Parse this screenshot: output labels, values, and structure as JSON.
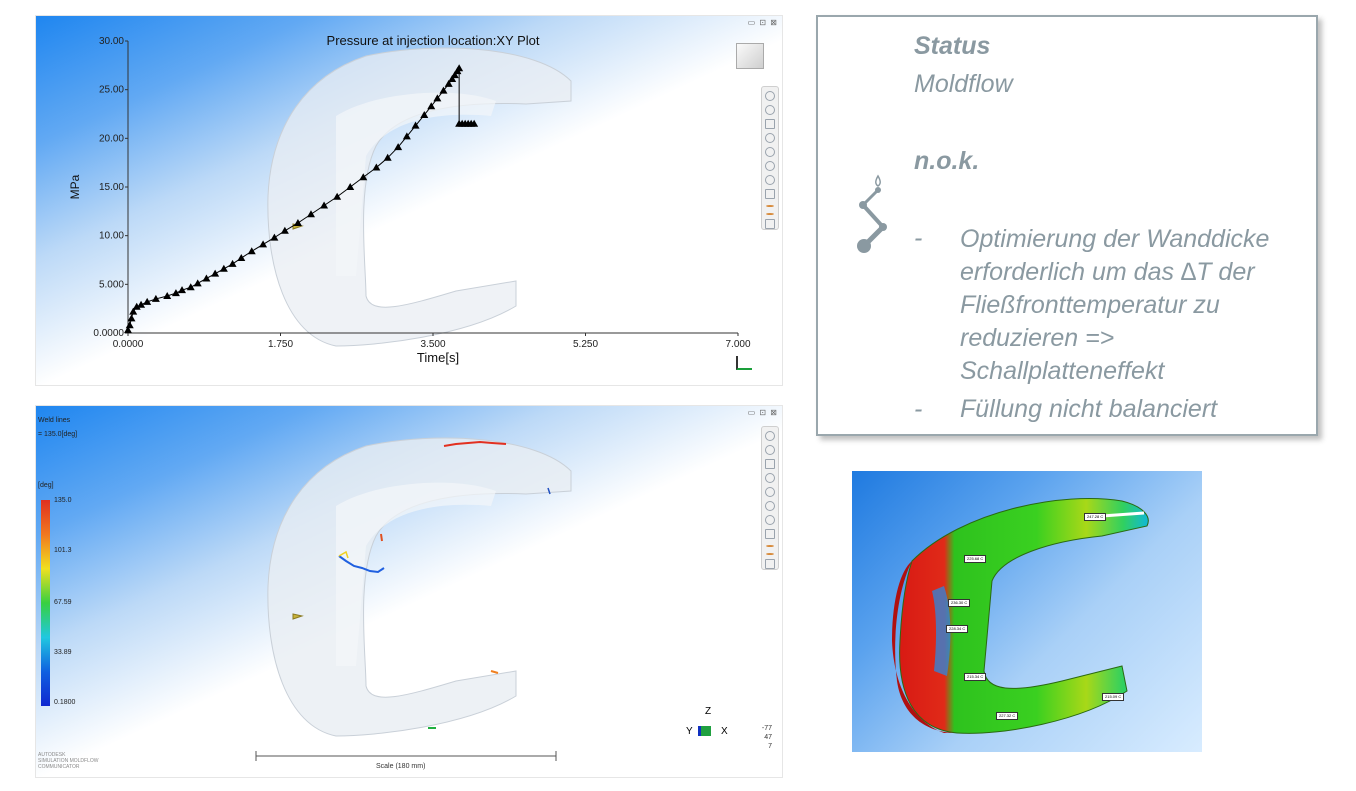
{
  "plot_panel": {
    "title": "Pressure at injection location:XY Plot",
    "window_controls": "▭ ⊡ ⊠"
  },
  "chart_data": {
    "type": "scatter",
    "title": "Pressure at injection location:XY Plot",
    "xlabel": "Time[s]",
    "ylabel": "MPa",
    "xlim": [
      0,
      7.0
    ],
    "ylim": [
      0,
      30.0
    ],
    "x_ticks": [
      "0.0000",
      "1.750",
      "3.500",
      "5.250",
      "7.000"
    ],
    "y_ticks": [
      "0.0000",
      "5.000",
      "10.00",
      "15.00",
      "20.00",
      "25.00",
      "30.00"
    ],
    "x": [
      0.0,
      0.02,
      0.04,
      0.06,
      0.1,
      0.15,
      0.22,
      0.32,
      0.45,
      0.55,
      0.62,
      0.72,
      0.8,
      0.9,
      1.0,
      1.1,
      1.2,
      1.3,
      1.42,
      1.55,
      1.68,
      1.8,
      1.95,
      2.1,
      2.25,
      2.4,
      2.55,
      2.7,
      2.85,
      2.98,
      3.1,
      3.2,
      3.3,
      3.4,
      3.48,
      3.55,
      3.62,
      3.68,
      3.72,
      3.75,
      3.78,
      3.8
    ],
    "y": [
      0.3,
      0.8,
      1.5,
      2.2,
      2.7,
      2.9,
      3.2,
      3.5,
      3.8,
      4.1,
      4.4,
      4.7,
      5.1,
      5.6,
      6.1,
      6.6,
      7.1,
      7.7,
      8.4,
      9.1,
      9.8,
      10.5,
      11.3,
      12.2,
      13.1,
      14.0,
      15.0,
      16.0,
      17.0,
      18.0,
      19.1,
      20.2,
      21.3,
      22.4,
      23.3,
      24.1,
      24.9,
      25.6,
      26.1,
      26.5,
      26.9,
      27.2
    ],
    "drop_x": 3.8,
    "drop_y": 21.5,
    "marker": "triangle",
    "color": "#000000"
  },
  "weld_panel": {
    "result_name": "Weld lines",
    "result_value": "= 135.0[deg]",
    "unit": "[deg]",
    "legend_ticks": [
      "135.0",
      "101.3",
      "67.59",
      "33.89",
      "0.1800"
    ],
    "scale_label": "Scale (180 mm)",
    "axis_labels": {
      "z": "Z",
      "y": "Y",
      "x": "X"
    },
    "view_angles": [
      "-77",
      "47",
      "7"
    ],
    "footer_lines": [
      "AUTODESK",
      "SIMULATION MOLDFLOW",
      "COMMUNICATOR"
    ]
  },
  "status_box": {
    "heading": "Status",
    "subheading": "Moldflow",
    "verdict": "n.o.k.",
    "dash": "-",
    "bullets": [
      "Optimierung der Wanddicke erforderlich um das ∆T der Fließfronttemperatur zu reduzieren => Schallplatteneffekt",
      "Füllung nicht balanciert"
    ],
    "icon": "injection-flow-icon"
  },
  "temp_panel": {
    "tags": [
      "247.28 C",
      "225.68 C",
      "236.30 C",
      "228.34 C",
      "215.34 C",
      "227.32 C",
      "215.09 C"
    ]
  },
  "colors": {
    "status_text": "#8a99a1",
    "background_blue": "#1f86f0",
    "legend_top": "#e03020",
    "legend_bottom": "#1028d0"
  }
}
